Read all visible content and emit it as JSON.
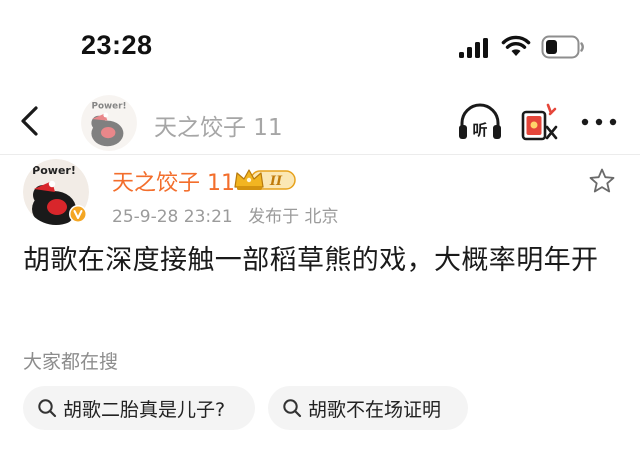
{
  "status_bar": {
    "time": "23:28",
    "icons": [
      "signal-icon",
      "wifi-icon",
      "battery-icon"
    ]
  },
  "nav": {
    "author_name": "天之饺子 11",
    "avatar_badge_text": "Power!",
    "actions": [
      "back-icon",
      "headphone-listen-icon",
      "red-envelope-icon",
      "more-icon"
    ],
    "listen_label": "听"
  },
  "post": {
    "author_name": "天之饺子 11",
    "avatar_badge_text": "Power!",
    "level_badge": "II",
    "date": "25-9-28 23:21",
    "location": "发布于 北京",
    "text": "胡歌在深度接触一部稻草熊的戏，大概率明年开"
  },
  "search": {
    "section_title": "大家都在搜",
    "chips": [
      {
        "label": "胡歌二胎真是儿子?"
      },
      {
        "label": "胡歌不在场证明"
      }
    ]
  },
  "colors": {
    "accent_orange": "#f36e2c",
    "gold": "#e7a21d",
    "red_envelope": "#e5463a",
    "muted_text": "#9b9b9b",
    "chip_bg": "#f4f4f4"
  }
}
